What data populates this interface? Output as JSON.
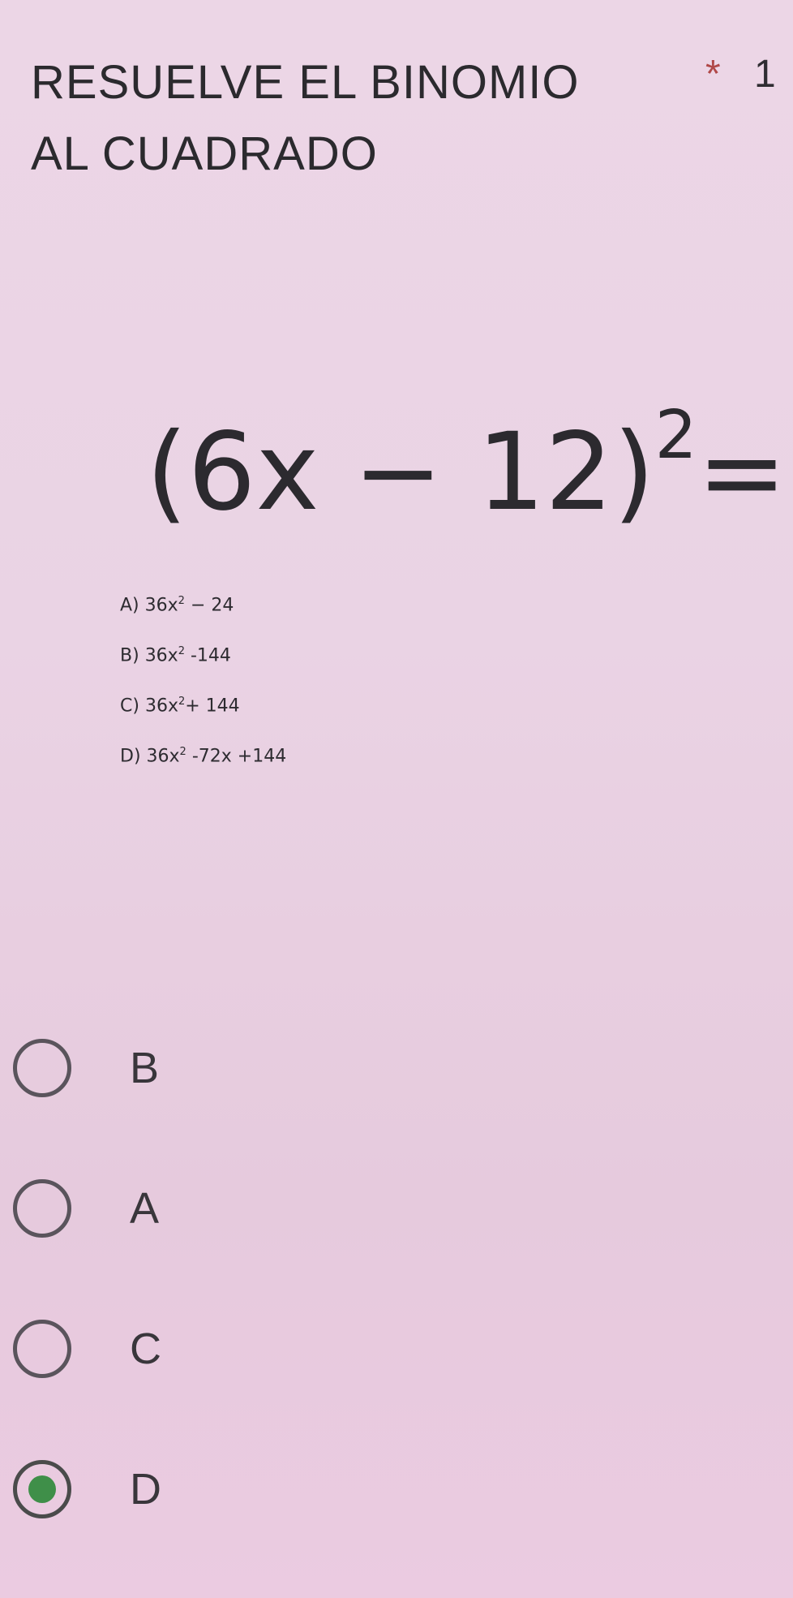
{
  "question": {
    "title": "RESUELVE EL BINOMIO AL CUADRADO",
    "required_mark": "*",
    "points": "1",
    "equation_base": "(6x − 12)",
    "equation_exponent": "2",
    "equation_suffix": "="
  },
  "listed_choices": [
    {
      "prefix": "A)",
      "lead": "36x",
      "exp": "2",
      "tail": "− 24"
    },
    {
      "prefix": "B)",
      "lead": "36x",
      "exp": "2",
      "tail": "-144"
    },
    {
      "prefix": "C)",
      "lead": "36x",
      "exp": "2",
      "tail": "+ 144"
    },
    {
      "prefix": "D)",
      "lead": "36x",
      "exp": "2",
      "tail": "-72x +144"
    }
  ],
  "options": [
    {
      "label": "B",
      "selected": false
    },
    {
      "label": "A",
      "selected": false
    },
    {
      "label": "C",
      "selected": false
    },
    {
      "label": "D",
      "selected": true
    }
  ],
  "colors": {
    "selected_dot": "#3f8f49",
    "required": "#b04848"
  }
}
